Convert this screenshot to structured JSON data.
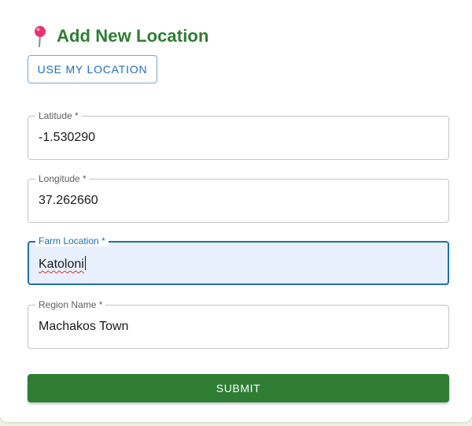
{
  "header": {
    "icon": "map-pin-icon",
    "title": "Add New Location"
  },
  "actions": {
    "use_my_location_label": "USE MY LOCATION",
    "submit_label": "SUBMIT"
  },
  "form": {
    "latitude": {
      "label": "Latitude *",
      "value": "-1.530290"
    },
    "longitude": {
      "label": "Longitude *",
      "value": "37.262660"
    },
    "farm_location": {
      "label": "Farm Location *",
      "value": "Katoloni"
    },
    "region_name": {
      "label": "Region Name *",
      "value": "Machakos Town"
    }
  },
  "colors": {
    "primary_green": "#2e7d32",
    "focus_blue": "#1f6fb3",
    "focus_fill": "#e8f0fe",
    "pin_red": "#e8336d"
  }
}
